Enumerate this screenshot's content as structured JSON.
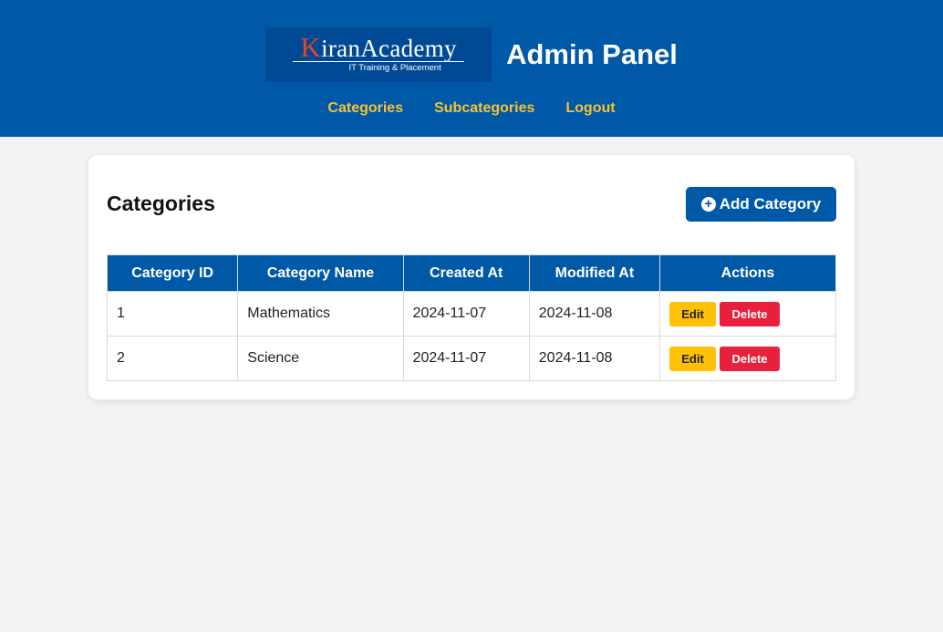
{
  "header": {
    "logo": {
      "letter_k": "K",
      "name_rest": "iranAcademy",
      "tagline": "IT Training & Placement"
    },
    "title": "Admin Panel",
    "nav": [
      {
        "label": "Categories"
      },
      {
        "label": "Subcategories"
      },
      {
        "label": "Logout"
      }
    ]
  },
  "main": {
    "title": "Categories",
    "add_button": {
      "label": "Add Category",
      "icon": "plus-circle-icon"
    },
    "table": {
      "columns": [
        "Category ID",
        "Category Name",
        "Created At",
        "Modified At",
        "Actions"
      ],
      "rows": [
        {
          "id": "1",
          "name": "Mathematics",
          "created": "2024-11-07",
          "modified": "2024-11-08",
          "edit": "Edit",
          "delete": "Delete"
        },
        {
          "id": "2",
          "name": "Science",
          "created": "2024-11-07",
          "modified": "2024-11-08",
          "edit": "Edit",
          "delete": "Delete"
        }
      ]
    }
  },
  "colors": {
    "primary": "#0059a7",
    "nav_link": "#f7c232",
    "edit": "#ffc107",
    "delete": "#e8203c",
    "background": "#f2f3f5",
    "logo_accent": "#e8432a"
  }
}
